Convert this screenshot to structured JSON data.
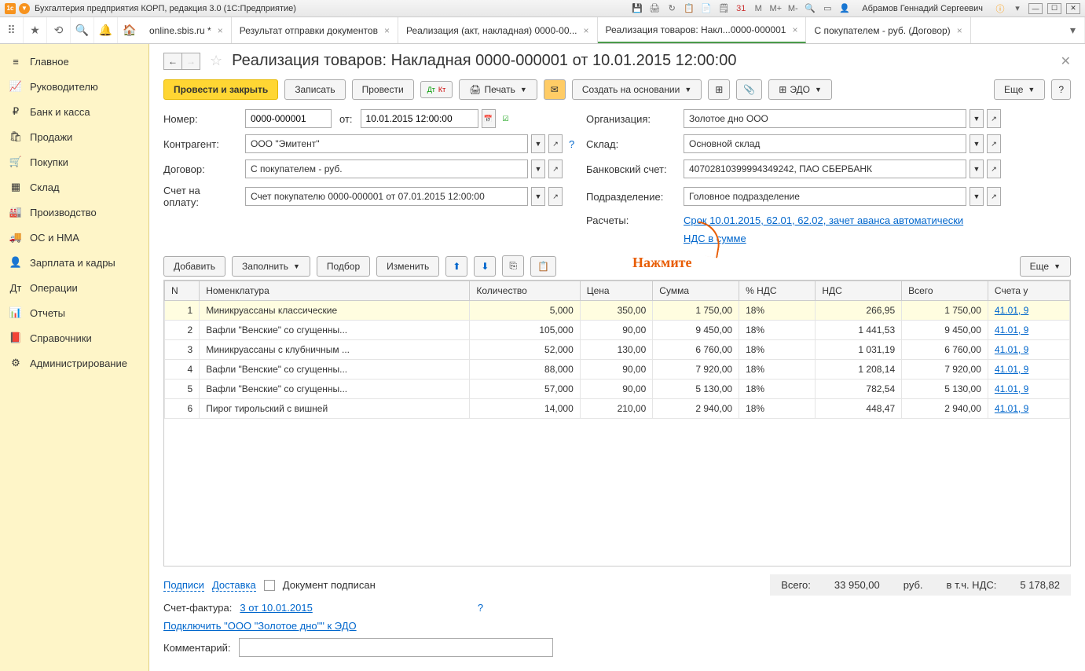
{
  "titlebar": {
    "title": "Бухгалтерия предприятия КОРП, редакция 3.0  (1С:Предприятие)",
    "user": "Абрамов Геннадий Сергеевич",
    "m": "M",
    "mplus": "M+",
    "mminus": "M-"
  },
  "tabs": [
    {
      "label": "online.sbis.ru *"
    },
    {
      "label": "Результат отправки документов"
    },
    {
      "label": "Реализация (акт, накладная) 0000-00..."
    },
    {
      "label": "Реализация товаров: Накл...0000-000001",
      "active": true
    },
    {
      "label": "С покупателем - руб. (Договор)"
    }
  ],
  "sidebar": [
    {
      "icon": "≡",
      "label": "Главное"
    },
    {
      "icon": "📈",
      "label": "Руководителю"
    },
    {
      "icon": "₽",
      "label": "Банк и касса"
    },
    {
      "icon": "🛍",
      "label": "Продажи"
    },
    {
      "icon": "🛒",
      "label": "Покупки"
    },
    {
      "icon": "▦",
      "label": "Склад"
    },
    {
      "icon": "🏭",
      "label": "Производство"
    },
    {
      "icon": "🚚",
      "label": "ОС и НМА"
    },
    {
      "icon": "👤",
      "label": "Зарплата и кадры"
    },
    {
      "icon": "Дт",
      "label": "Операции"
    },
    {
      "icon": "📊",
      "label": "Отчеты"
    },
    {
      "icon": "📕",
      "label": "Справочники"
    },
    {
      "icon": "⚙",
      "label": "Администрирование"
    }
  ],
  "header": {
    "title": "Реализация товаров: Накладная 0000-000001 от 10.01.2015 12:00:00"
  },
  "toolbar": {
    "post_close": "Провести и закрыть",
    "save": "Записать",
    "post": "Провести",
    "print": "Печать",
    "create_based": "Создать на основании",
    "edo": "ЭДО",
    "more": "Еще"
  },
  "form": {
    "number_lbl": "Номер:",
    "number": "0000-000001",
    "from_lbl": "от:",
    "date": "10.01.2015 12:00:00",
    "org_lbl": "Организация:",
    "org": "Золотое дно ООО",
    "contr_lbl": "Контрагент:",
    "contr": "ООО \"Эмитент\"",
    "wh_lbl": "Склад:",
    "wh": "Основной склад",
    "contract_lbl": "Договор:",
    "contract": "С покупателем - руб.",
    "bank_lbl": "Банковский счет:",
    "bank": "40702810399994349242, ПАО СБЕРБАНК",
    "invoice_lbl": "Счет на оплату:",
    "invoice": "Счет покупателю 0000-000001 от 07.01.2015 12:00:00",
    "dept_lbl": "Подразделение:",
    "dept": "Головное подразделение",
    "calc_lbl": "Расчеты:",
    "calc_link": "Срок 10.01.2015, 62.01, 62.02, зачет аванса автоматически",
    "nds_link": "НДС в сумме"
  },
  "annotation": "Нажмите",
  "tabletools": {
    "add": "Добавить",
    "fill": "Заполнить",
    "pick": "Подбор",
    "change": "Изменить",
    "more": "Еще"
  },
  "cols": [
    "N",
    "Номенклатура",
    "Количество",
    "Цена",
    "Сумма",
    "% НДС",
    "НДС",
    "Всего",
    "Счета у"
  ],
  "rows": [
    {
      "n": 1,
      "name": "Миникруассаны классические",
      "qty": "5,000",
      "price": "350,00",
      "sum": "1 750,00",
      "vat": "18%",
      "nds": "266,95",
      "total": "1 750,00",
      "acct": "41.01, 9"
    },
    {
      "n": 2,
      "name": "Вафли \"Венские\" со сгущенны...",
      "qty": "105,000",
      "price": "90,00",
      "sum": "9 450,00",
      "vat": "18%",
      "nds": "1 441,53",
      "total": "9 450,00",
      "acct": "41.01, 9"
    },
    {
      "n": 3,
      "name": "Миникруассаны с клубничным ...",
      "qty": "52,000",
      "price": "130,00",
      "sum": "6 760,00",
      "vat": "18%",
      "nds": "1 031,19",
      "total": "6 760,00",
      "acct": "41.01, 9"
    },
    {
      "n": 4,
      "name": "Вафли \"Венские\" со сгущенны...",
      "qty": "88,000",
      "price": "90,00",
      "sum": "7 920,00",
      "vat": "18%",
      "nds": "1 208,14",
      "total": "7 920,00",
      "acct": "41.01, 9"
    },
    {
      "n": 5,
      "name": "Вафли \"Венские\" со сгущенны...",
      "qty": "57,000",
      "price": "90,00",
      "sum": "5 130,00",
      "vat": "18%",
      "nds": "782,54",
      "total": "5 130,00",
      "acct": "41.01, 9"
    },
    {
      "n": 6,
      "name": "Пирог тирольский с вишней",
      "qty": "14,000",
      "price": "210,00",
      "sum": "2 940,00",
      "vat": "18%",
      "nds": "448,47",
      "total": "2 940,00",
      "acct": "41.01, 9"
    }
  ],
  "footer": {
    "sign": "Подписи",
    "delivery": "Доставка",
    "signed": "Документ подписан",
    "total_lbl": "Всего:",
    "total": "33 950,00",
    "cur": "руб.",
    "vat_lbl": "в т.ч. НДС:",
    "vat": "5 178,82",
    "sf_lbl": "Счет-фактура:",
    "sf_link": "3 от 10.01.2015",
    "edo_link": "Подключить \"ООО \"Золотое дно\"\" к ЭДО",
    "comment_lbl": "Комментарий:"
  }
}
